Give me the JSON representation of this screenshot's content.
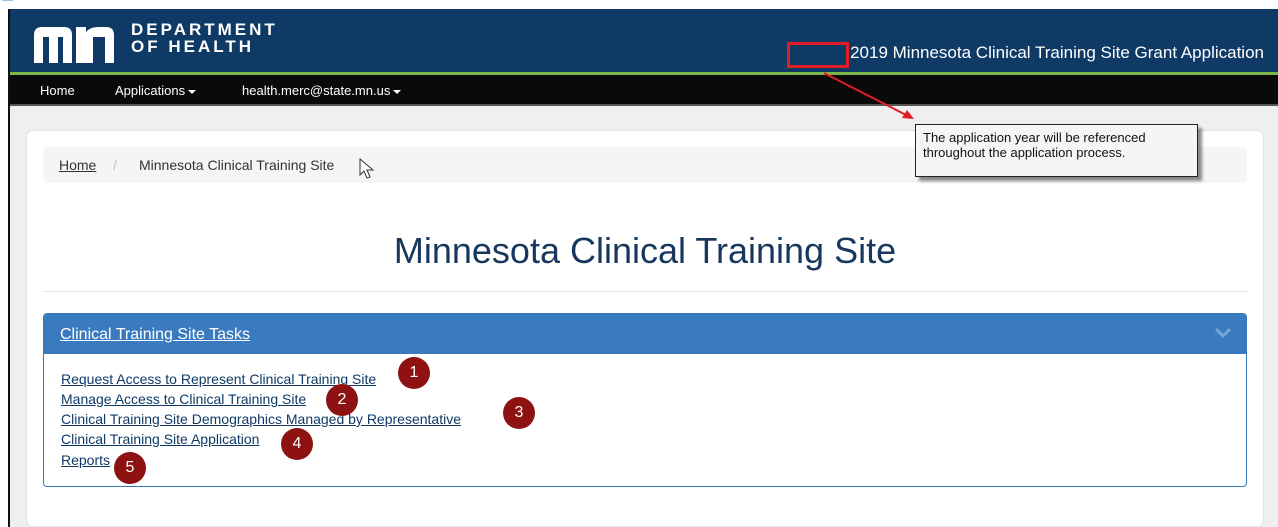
{
  "header": {
    "department_line1": "DEPARTMENT",
    "department_line2": "OF HEALTH",
    "application_title": "2019 Minnesota Clinical Training Site Grant Application",
    "year": "2019",
    "brand_color": "#0f3a66",
    "accent_green": "#7ab648"
  },
  "nav": {
    "home": "Home",
    "applications": "Applications",
    "user": "health.merc@state.mn.us"
  },
  "breadcrumb": {
    "home": "Home",
    "separator": "/",
    "current": "Minnesota Clinical Training Site"
  },
  "page": {
    "title": "Minnesota Clinical Training Site"
  },
  "tasks": {
    "heading": "Clinical Training Site Tasks",
    "header_color": "#3a7bbf",
    "items": [
      {
        "label": "Request Access to Represent Clinical Training Site",
        "number": "1"
      },
      {
        "label": "Manage Access to Clinical Training Site",
        "number": "2"
      },
      {
        "label": "Clinical Training Site Demographics Managed by Representative",
        "number": "3"
      },
      {
        "label": "Clinical Training Site Application",
        "number": "4"
      },
      {
        "label": "Reports",
        "number": "5"
      }
    ]
  },
  "annotation": {
    "callout_text": "The application year will be referenced throughout the application process.",
    "highlight_color": "#e21d23",
    "number_badge_color": "#8e1212"
  },
  "icons": {
    "logo": "mn-logo-icon",
    "chevron": "chevron-down-icon",
    "cursor": "mouse-pointer-icon"
  }
}
